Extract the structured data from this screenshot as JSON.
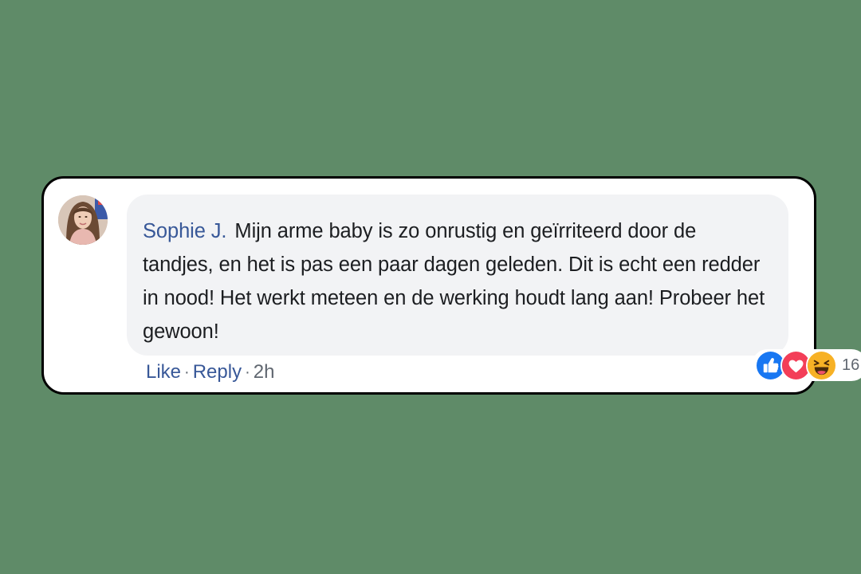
{
  "comment": {
    "author": "Sophie J.",
    "text": "Mijn arme baby is zo onrustig en geïrriteerd door de tandjes, en het is pas een paar dagen geleden. Dit is echt een redder in nood! Het werkt meteen en de werking houdt lang aan! Probeer het gewoon!"
  },
  "reactions": {
    "icons": [
      "like-icon",
      "love-icon",
      "haha-icon"
    ],
    "count": "16"
  },
  "actions": {
    "like_label": "Like",
    "reply_label": "Reply",
    "separator": "·",
    "time": "2h"
  },
  "colors": {
    "background": "#5f8b68",
    "author": "#385898",
    "bubble": "#f2f3f5",
    "like": "#1877f2",
    "love": "#f33e58",
    "haha": "#f7b125"
  }
}
